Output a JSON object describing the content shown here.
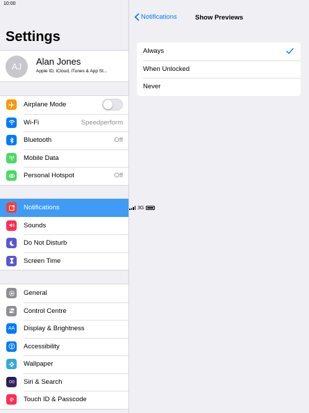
{
  "status_bar": {
    "time": "10:00",
    "network": "3G"
  },
  "sidebar": {
    "title": "Settings",
    "profile": {
      "initials": "AJ",
      "name": "Alan Jones",
      "subtitle": "Apple ID, iCloud, iTunes & App St..."
    },
    "group1": [
      {
        "label": "Airplane Mode",
        "icon": "airplane-icon",
        "color": "#ff9500"
      },
      {
        "label": "Wi-Fi",
        "value": "Speedperform",
        "icon": "wifi-icon",
        "color": "#007aff"
      },
      {
        "label": "Bluetooth",
        "value": "Off",
        "icon": "bluetooth-icon",
        "color": "#007aff"
      },
      {
        "label": "Mobile Data",
        "icon": "antenna-icon",
        "color": "#4cd964"
      },
      {
        "label": "Personal Hotspot",
        "value": "Off",
        "icon": "hotspot-icon",
        "color": "#4cd964"
      }
    ],
    "group2": [
      {
        "label": "Notifications",
        "icon": "notifications-icon",
        "color": "#ff3b30",
        "selected": true
      },
      {
        "label": "Sounds",
        "icon": "speaker-icon",
        "color": "#ff2d55"
      },
      {
        "label": "Do Not Disturb",
        "icon": "moon-icon",
        "color": "#5856d6"
      },
      {
        "label": "Screen Time",
        "icon": "hourglass-icon",
        "color": "#5856d6"
      }
    ],
    "group3": [
      {
        "label": "General",
        "icon": "gear-icon",
        "color": "#8e8e93"
      },
      {
        "label": "Control Centre",
        "icon": "switches-icon",
        "color": "#8e8e93"
      },
      {
        "label": "Display & Brightness",
        "icon": "display-icon",
        "color": "#007aff",
        "glyph": "AA"
      },
      {
        "label": "Accessibility",
        "icon": "accessibility-icon",
        "color": "#007aff"
      },
      {
        "label": "Wallpaper",
        "icon": "flower-icon",
        "color": "#34aadc"
      },
      {
        "label": "Siri & Search",
        "icon": "siri-icon",
        "color": "#1c1c3a"
      },
      {
        "label": "Touch ID & Passcode",
        "icon": "fingerprint-icon",
        "color": "#ff2d55"
      }
    ]
  },
  "detail": {
    "back_label": "Notifications",
    "title": "Show Previews",
    "options": [
      {
        "label": "Always",
        "checked": true
      },
      {
        "label": "When Unlocked",
        "checked": false
      },
      {
        "label": "Never",
        "checked": false
      }
    ]
  },
  "colors": {
    "accent": "#007aff",
    "selected_row": "#3f9bf5"
  }
}
